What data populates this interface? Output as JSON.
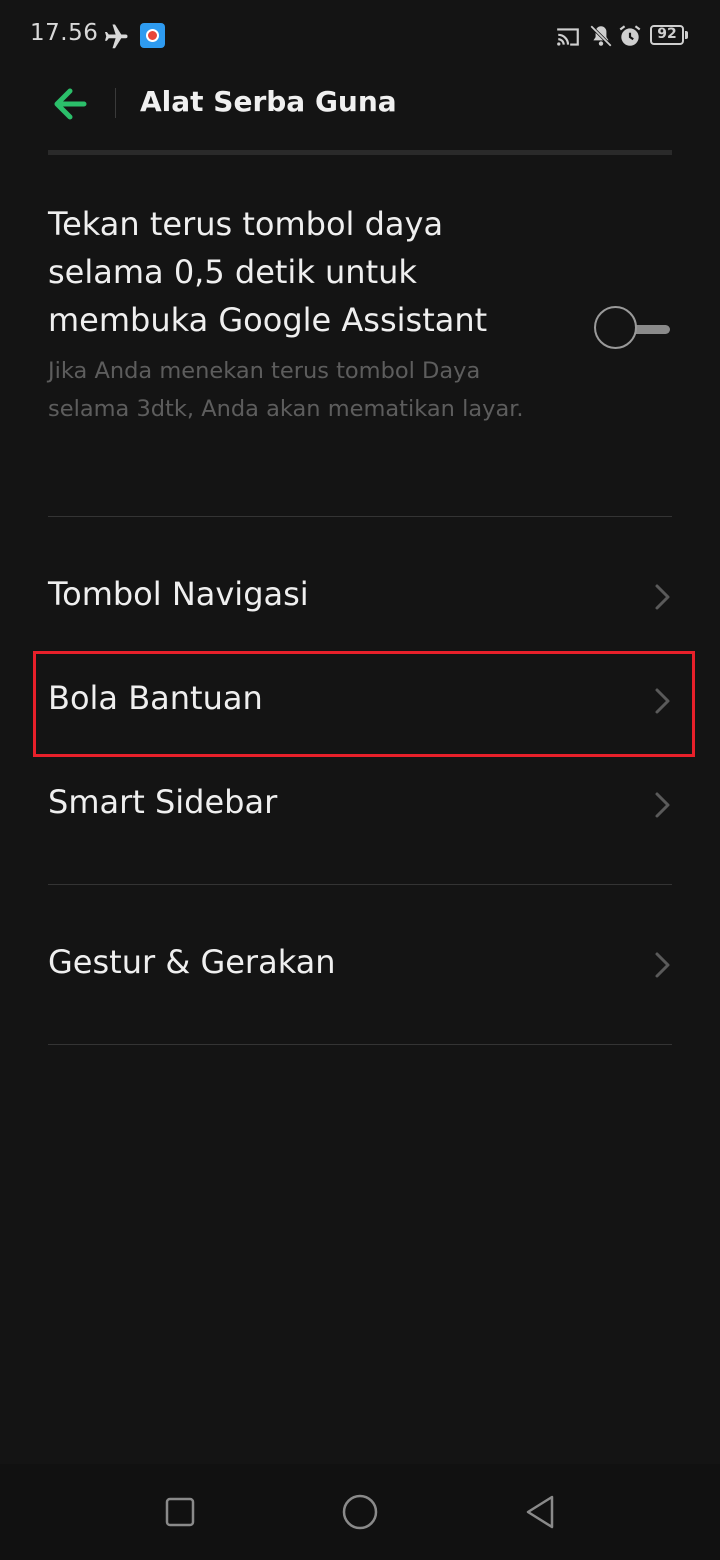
{
  "status_bar": {
    "time": "17.56",
    "battery": "92",
    "icons": [
      "airplane-icon",
      "screen-recorder-icon",
      "cast-icon",
      "mute-icon",
      "alarm-icon",
      "battery-icon"
    ]
  },
  "header": {
    "title": "Alat Serba Guna",
    "back_icon": "arrow-left-icon",
    "accent_color": "#2bbf6a"
  },
  "toggle_setting": {
    "title": "Tekan terus tombol daya selama 0,5 detik untuk membuka Google Assistant",
    "description": "Jika Anda menekan terus tombol Daya selama 3dtk, Anda akan mematikan layar.",
    "enabled": false
  },
  "menu_items": [
    {
      "label": "Tombol Navigasi",
      "icon": "chevron-right-icon"
    },
    {
      "label": "Bola Bantuan",
      "icon": "chevron-right-icon",
      "highlighted": true,
      "highlight_color": "#e8202a"
    },
    {
      "label": "Smart Sidebar",
      "icon": "chevron-right-icon"
    },
    {
      "label": "Gestur & Gerakan",
      "icon": "chevron-right-icon"
    }
  ],
  "nav_bar": {
    "buttons": [
      "recents-square-icon",
      "home-circle-icon",
      "back-triangle-icon"
    ]
  }
}
